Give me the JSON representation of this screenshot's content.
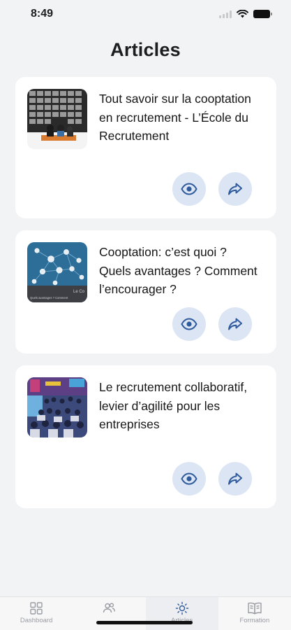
{
  "status_bar": {
    "time": "8:49"
  },
  "header": {
    "title": "Articles"
  },
  "articles": [
    {
      "title": "Tout savoir sur la cooptation en recrutement - L’École du Recrutement",
      "image": "conference-audience-screen-image"
    },
    {
      "title": "Cooptation: c’est quoi ? Quels avantages ? Comment l’encourager ?",
      "image": "network-diagram-image",
      "image_caption": "Le Co",
      "image_subcaption": "Quels avantages ? Comment"
    },
    {
      "title": "Le recrutement collaboratif, levier d’agilité pour les entreprises",
      "image": "event-crowd-image"
    }
  ],
  "tabs": [
    {
      "label": "Dashboard",
      "icon": "grid-icon"
    },
    {
      "label": "",
      "icon": "users-icon"
    },
    {
      "label": "Articles",
      "icon": "sun-icon",
      "active": true
    },
    {
      "label": "Formation",
      "icon": "book-icon"
    }
  ],
  "colors": {
    "accent": "#2f5a9c",
    "action_bg": "#dbe5f3",
    "background": "#f2f3f5"
  }
}
